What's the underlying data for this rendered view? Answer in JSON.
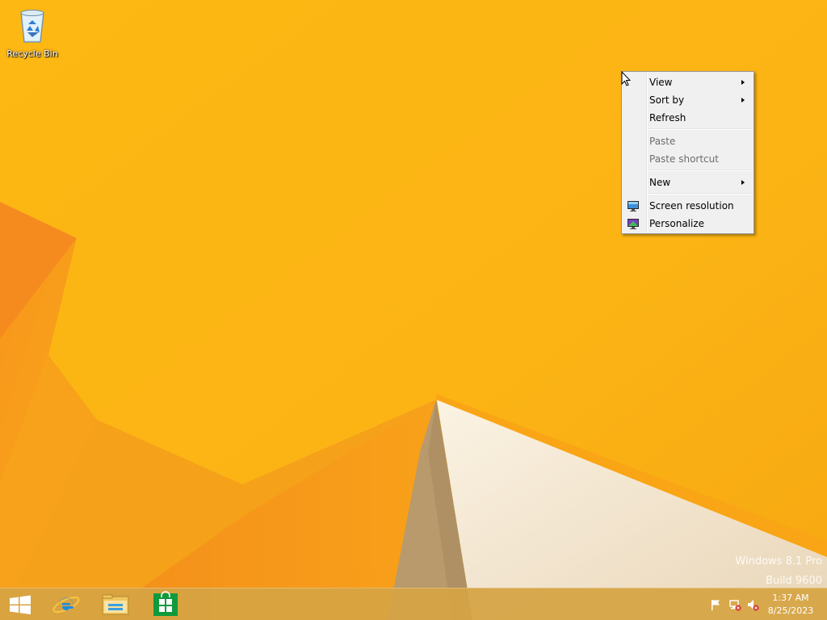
{
  "desktop": {
    "icons": [
      {
        "label": "Recycle Bin",
        "icon": "recycle-bin-icon"
      }
    ],
    "watermark": {
      "line1": "Windows 8.1 Pro",
      "line2": "Build 9600"
    },
    "colors": {
      "background": "#fbb414",
      "light_facet": "#f3e6cf",
      "orange_facet": "#f58b1e"
    }
  },
  "context_menu": {
    "items": [
      {
        "label": "View",
        "submenu": true,
        "enabled": true
      },
      {
        "label": "Sort by",
        "submenu": true,
        "enabled": true
      },
      {
        "label": "Refresh",
        "submenu": false,
        "enabled": true
      },
      {
        "label": "Paste",
        "submenu": false,
        "enabled": false
      },
      {
        "label": "Paste shortcut",
        "submenu": false,
        "enabled": false
      },
      {
        "label": "New",
        "submenu": true,
        "enabled": true
      },
      {
        "label": "Screen resolution",
        "submenu": false,
        "enabled": true,
        "icon": "display-icon"
      },
      {
        "label": "Personalize",
        "submenu": false,
        "enabled": true,
        "icon": "personalize-icon"
      }
    ]
  },
  "taskbar": {
    "start": {
      "icon": "windows-logo-icon"
    },
    "pinned": [
      {
        "name": "Internet Explorer",
        "icon": "internet-explorer-icon"
      },
      {
        "name": "File Explorer",
        "icon": "file-explorer-icon"
      },
      {
        "name": "Store",
        "icon": "store-icon"
      }
    ],
    "tray": {
      "icons": [
        "action-center-flag-icon",
        "network-disconnected-icon",
        "volume-muted-icon"
      ],
      "time": "1:37 AM",
      "date": "8/25/2023"
    }
  }
}
